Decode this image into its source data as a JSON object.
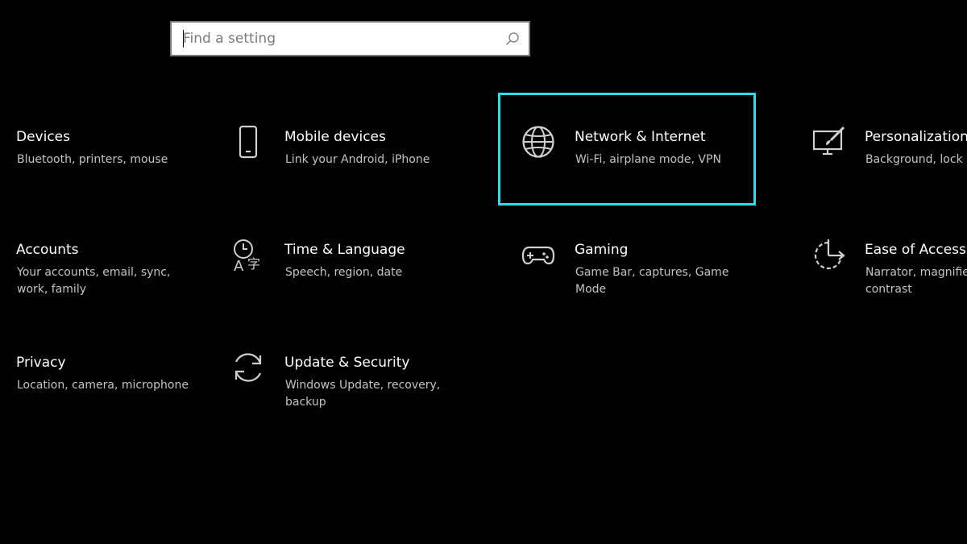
{
  "search": {
    "placeholder": "Find a setting"
  },
  "colors": {
    "background": "#000000",
    "focus_border": "#29e0e6",
    "text_primary": "#ffffff",
    "text_secondary": "#c4c4c4"
  },
  "tiles": [
    {
      "title": "Devices",
      "desc": "Bluetooth, printers, mouse",
      "icon": "keyboard-icon"
    },
    {
      "title": "Mobile devices",
      "desc": "Link your Android, iPhone",
      "icon": "phone-icon"
    },
    {
      "title": "Network & Internet",
      "desc": "Wi-Fi, airplane mode, VPN",
      "icon": "globe-icon",
      "focused": true
    },
    {
      "title": "Personalization",
      "desc": "Background, lock screen, colors",
      "icon": "paintbrush-icon"
    },
    {
      "title": "Accounts",
      "desc": "Your accounts, email, sync, work, family",
      "icon": "person-icon"
    },
    {
      "title": "Time & Language",
      "desc": "Speech, region, date",
      "icon": "time-language-icon"
    },
    {
      "title": "Gaming",
      "desc": "Game Bar, captures, Game Mode",
      "icon": "gamepad-icon"
    },
    {
      "title": "Ease of Access",
      "desc": "Narrator, magnifier, high contrast",
      "icon": "ease-of-access-icon"
    },
    {
      "title": "Privacy",
      "desc": "Location, camera, microphone",
      "icon": "lock-icon"
    },
    {
      "title": "Update & Security",
      "desc": "Windows Update, recovery, backup",
      "icon": "sync-icon"
    }
  ]
}
